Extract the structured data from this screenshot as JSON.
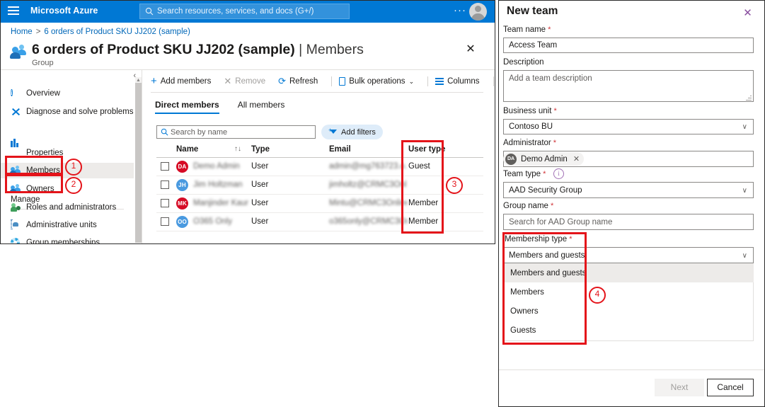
{
  "azure": {
    "topbar": {
      "brand": "Microsoft Azure",
      "search_placeholder": "Search resources, services, and docs (G+/)",
      "more_dots": "···",
      "menu_icon": "hamburger-icon",
      "account_icon": "account-avatar-icon"
    },
    "breadcrumb": {
      "home": "Home",
      "separator": ">",
      "current": "6 orders of Product SKU JJ202 (sample)"
    },
    "header": {
      "title_bold": "6 orders of Product SKU JJ202 (sample)",
      "title_divider": "|",
      "title_light": "Members",
      "subtitle": "Group",
      "dots": "···",
      "close": "✕"
    },
    "leftnav": {
      "collapse": "«",
      "group_label": "Manage",
      "items": [
        {
          "label": "Overview",
          "icon": "info-icon",
          "selected": false
        },
        {
          "label": "Diagnose and solve problems",
          "icon": "wrench-icon",
          "selected": false
        },
        {
          "label": "Properties",
          "icon": "properties-bars-icon",
          "selected": false
        },
        {
          "label": "Members",
          "icon": "people-icon",
          "selected": true
        },
        {
          "label": "Owners",
          "icon": "people-icon",
          "selected": false
        },
        {
          "label": "Roles and administrators",
          "icon": "role-person-icon",
          "selected": false
        },
        {
          "label": "Administrative units",
          "icon": "administrative-unit-icon",
          "selected": false
        },
        {
          "label": "Group memberships",
          "icon": "gear-icon",
          "selected": false
        }
      ]
    },
    "commandbar": {
      "add_members": "Add members",
      "remove": "Remove",
      "refresh": "Refresh",
      "bulk_operations": "Bulk operations",
      "columns": "Columns",
      "chevron": "⌄",
      "dots": "···"
    },
    "pivots": [
      {
        "label": "Direct members",
        "active": true
      },
      {
        "label": "All members",
        "active": false
      }
    ],
    "search": {
      "placeholder": "Search by name",
      "value": ""
    },
    "add_filters": {
      "label": "Add filters"
    },
    "table": {
      "columns": [
        "Name",
        "Type",
        "Email",
        "User type"
      ],
      "sort_glyph": "↑↓",
      "rows": [
        {
          "initials": "DA",
          "avatar_color": "#d60b25",
          "name": "Demo Admin",
          "type": "User",
          "email": "admin@mg763723.o...",
          "user_type": "Guest"
        },
        {
          "initials": "JH",
          "avatar_color": "#4a9ae0",
          "name": "Jim Holtzman",
          "type": "User",
          "email": "jimholtz@CRMC3Onli...",
          "user_type": ""
        },
        {
          "initials": "MK",
          "avatar_color": "#d60b25",
          "name": "Manjinder Kaur",
          "type": "User",
          "email": "Mintu@CRMC3Online...",
          "user_type": "Member"
        },
        {
          "initials": "OO",
          "avatar_color": "#4a9ae0",
          "name": "O365 Only",
          "type": "User",
          "email": "o365only@CRMC3On...",
          "user_type": "Member"
        }
      ]
    }
  },
  "newteam": {
    "title": "New team",
    "close": "✕",
    "fields": {
      "team_name": {
        "label": "Team name",
        "required": true,
        "value": "Access Team"
      },
      "description": {
        "label": "Description",
        "required": false,
        "placeholder": "Add a team description",
        "value": ""
      },
      "business_unit": {
        "label": "Business unit",
        "required": true,
        "value": "Contoso BU"
      },
      "administrator": {
        "label": "Administrator",
        "required": true,
        "pill_initials": "DA",
        "pill_name": "Demo Admin",
        "pill_remove": "✕"
      },
      "team_type": {
        "label": "Team type",
        "required": true,
        "value": "AAD Security Group",
        "info_glyph": "i"
      },
      "group_name": {
        "label": "Group name",
        "required": true,
        "placeholder": "Search for AAD Group name",
        "value": ""
      },
      "membership_type": {
        "label": "Membership type",
        "required": true,
        "value": "Members and guests",
        "options": [
          "Members and guests",
          "Members",
          "Owners",
          "Guests"
        ],
        "selected_index": 0
      }
    },
    "footer": {
      "next": "Next",
      "cancel": "Cancel"
    }
  },
  "annotations": {
    "callouts": [
      {
        "number": "1",
        "target": "sidebar-members"
      },
      {
        "number": "2",
        "target": "sidebar-owners"
      },
      {
        "number": "3",
        "target": "user-type-column"
      },
      {
        "number": "4",
        "target": "membership-type-dropdown"
      }
    ],
    "box_color": "#e4141a"
  }
}
